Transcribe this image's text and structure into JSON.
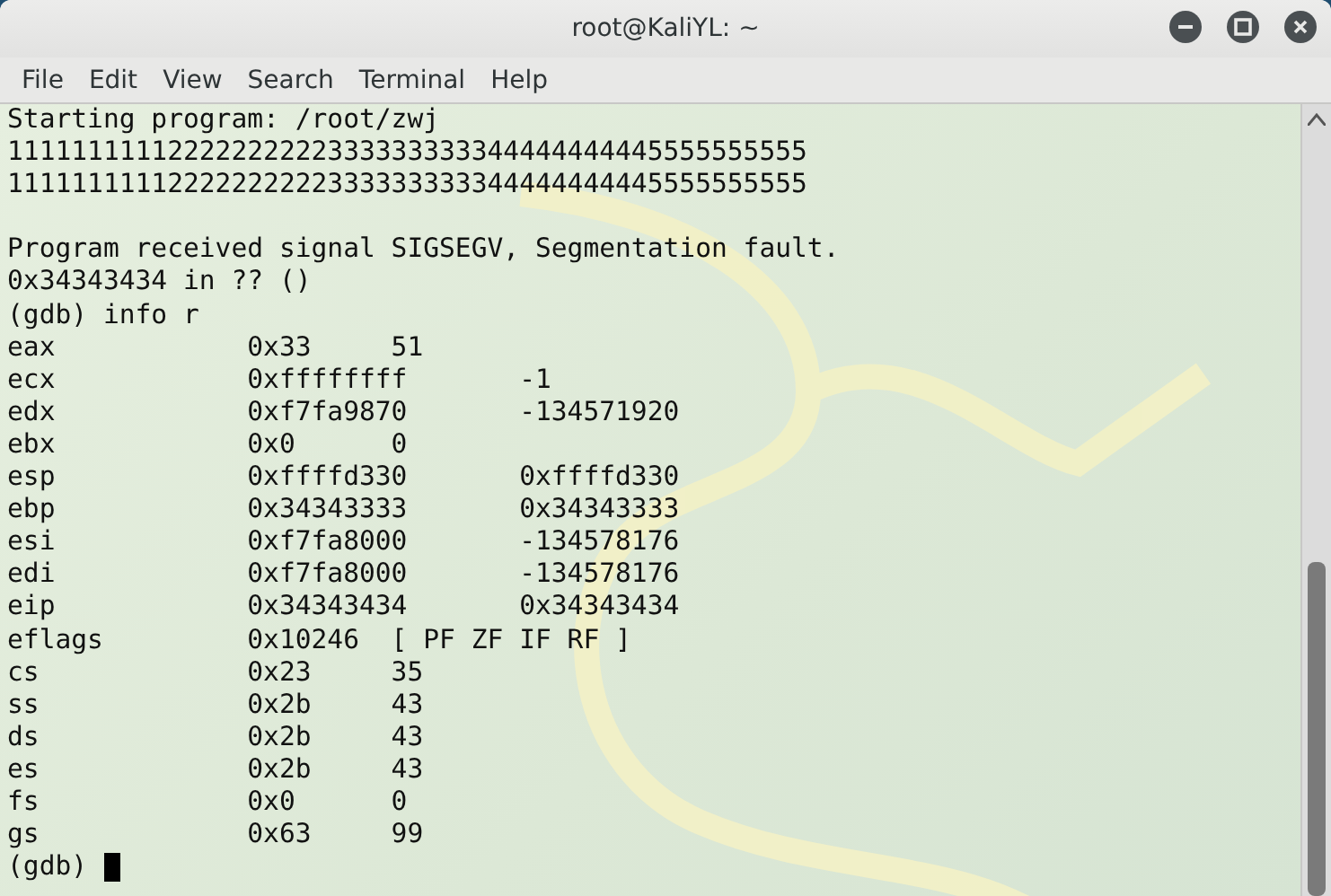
{
  "window": {
    "title": "root@KaliYL: ~"
  },
  "menu": [
    "File",
    "Edit",
    "View",
    "Search",
    "Terminal",
    "Help"
  ],
  "lines": [
    {
      "kind": "text",
      "text": "Starting program: /root/zwj"
    },
    {
      "kind": "text",
      "text": "11111111112222222222333333333344444444445555555555"
    },
    {
      "kind": "text",
      "text": "11111111112222222222333333333344444444445555555555"
    },
    {
      "kind": "blank"
    },
    {
      "kind": "text",
      "text": "Program received signal SIGSEGV, Segmentation fault."
    },
    {
      "kind": "text",
      "text": "0x34343434 in ?? ()"
    },
    {
      "kind": "text",
      "text": "(gdb) info r"
    },
    {
      "kind": "register",
      "name": "eax",
      "hex": "0x33",
      "value": "51"
    },
    {
      "kind": "register",
      "name": "ecx",
      "hex": "0xffffffff",
      "value": "-1"
    },
    {
      "kind": "register",
      "name": "edx",
      "hex": "0xf7fa9870",
      "value": "-134571920"
    },
    {
      "kind": "register",
      "name": "ebx",
      "hex": "0x0",
      "value": "0"
    },
    {
      "kind": "register",
      "name": "esp",
      "hex": "0xffffd330",
      "value": "0xffffd330"
    },
    {
      "kind": "register",
      "name": "ebp",
      "hex": "0x34343333",
      "value": "0x34343333"
    },
    {
      "kind": "register",
      "name": "esi",
      "hex": "0xf7fa8000",
      "value": "-134578176"
    },
    {
      "kind": "register",
      "name": "edi",
      "hex": "0xf7fa8000",
      "value": "-134578176"
    },
    {
      "kind": "register",
      "name": "eip",
      "hex": "0x34343434",
      "value": "0x34343434"
    },
    {
      "kind": "register",
      "name": "eflags",
      "hex": "0x10246",
      "value": "[ PF ZF IF RF ]"
    },
    {
      "kind": "register",
      "name": "cs",
      "hex": "0x23",
      "value": "35"
    },
    {
      "kind": "register",
      "name": "ss",
      "hex": "0x2b",
      "value": "43"
    },
    {
      "kind": "register",
      "name": "ds",
      "hex": "0x2b",
      "value": "43"
    },
    {
      "kind": "register",
      "name": "es",
      "hex": "0x2b",
      "value": "43"
    },
    {
      "kind": "register",
      "name": "fs",
      "hex": "0x0",
      "value": "0"
    },
    {
      "kind": "register",
      "name": "gs",
      "hex": "0x63",
      "value": "99"
    },
    {
      "kind": "prompt",
      "text": "(gdb)"
    }
  ]
}
